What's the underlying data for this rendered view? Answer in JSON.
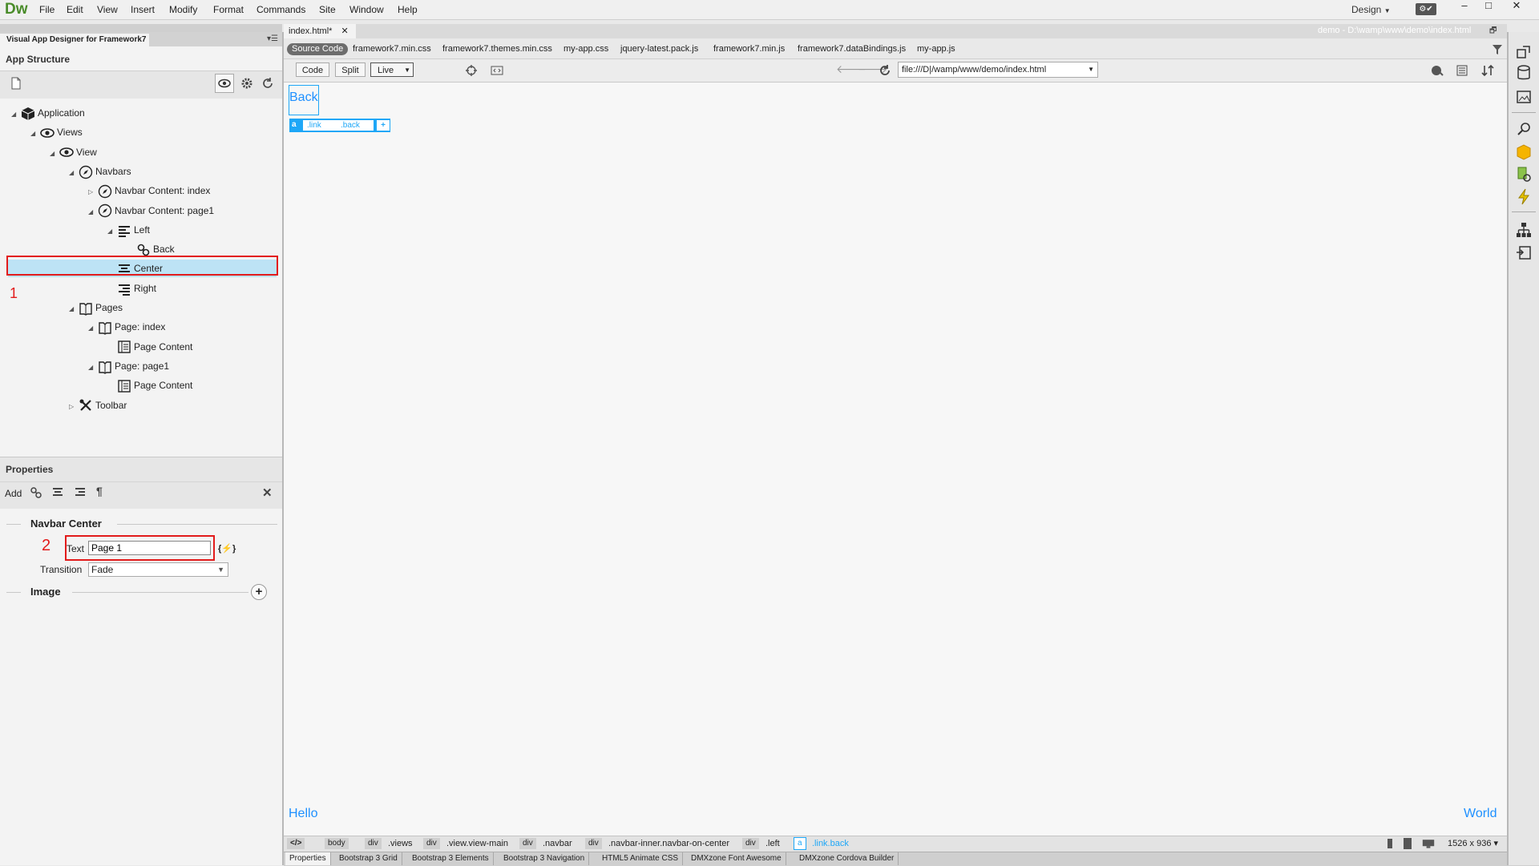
{
  "app": {
    "logo": "Dw",
    "menu": [
      "File",
      "Edit",
      "View",
      "Insert",
      "Modify",
      "Format",
      "Commands",
      "Site",
      "Window",
      "Help"
    ],
    "workspace": "Design",
    "window_controls": [
      "–",
      "□",
      "✕"
    ]
  },
  "left_panel": {
    "tab": "Visual App Designer for Framework7",
    "app_structure_title": "App Structure",
    "tree": [
      {
        "label": "Application",
        "level": 0,
        "arrow": "◢",
        "icon": "cube-icon"
      },
      {
        "label": "Views",
        "level": 1,
        "arrow": "◢",
        "icon": "eye-icon"
      },
      {
        "label": "View",
        "level": 2,
        "arrow": "◢",
        "icon": "eye-icon"
      },
      {
        "label": "Navbars",
        "level": 3,
        "arrow": "◢",
        "icon": "compass-icon"
      },
      {
        "label": "Navbar Content: index",
        "level": 4,
        "arrow": "▷",
        "icon": "compass-icon"
      },
      {
        "label": "Navbar Content: page1",
        "level": 4,
        "arrow": "◢",
        "icon": "compass-icon"
      },
      {
        "label": "Left",
        "level": 5,
        "arrow": "◢",
        "icon": "align-left-icon"
      },
      {
        "label": "Back",
        "level": 6,
        "arrow": "",
        "icon": "link-icon"
      },
      {
        "label": "Center",
        "level": 5,
        "arrow": "",
        "icon": "align-center-icon",
        "selected": true
      },
      {
        "label": "Right",
        "level": 5,
        "arrow": "",
        "icon": "align-right-icon"
      },
      {
        "label": "Pages",
        "level": 3,
        "arrow": "◢",
        "icon": "book-icon"
      },
      {
        "label": "Page: index",
        "level": 4,
        "arrow": "◢",
        "icon": "book-icon"
      },
      {
        "label": "Page Content",
        "level": 5,
        "arrow": "",
        "icon": "page-content-icon"
      },
      {
        "label": "Page: page1",
        "level": 4,
        "arrow": "◢",
        "icon": "book-icon"
      },
      {
        "label": "Page Content",
        "level": 5,
        "arrow": "",
        "icon": "page-content-icon"
      },
      {
        "label": "Toolbar",
        "level": 3,
        "arrow": "▷",
        "icon": "tools-icon"
      }
    ],
    "annotation_1": "1"
  },
  "properties": {
    "title": "Properties",
    "add_label": "Add",
    "section_title": "Navbar Center",
    "text_label": "Text",
    "text_value": "Page 1",
    "binding_glyph": "{⚡}",
    "transition_label": "Transition",
    "transition_value": "Fade",
    "image_section": "Image",
    "annotation_2": "2"
  },
  "document": {
    "tab_name": "index.html*",
    "path": "demo - D:\\wamp\\www\\demo\\index.html",
    "source_code_label": "Source Code",
    "related_files": [
      "framework7.min.css",
      "framework7.themes.min.css",
      "my-app.css",
      "jquery-latest.pack.js",
      "framework7.min.js",
      "framework7.dataBindings.js",
      "my-app.js"
    ],
    "views": [
      "Code",
      "Split",
      "Live"
    ],
    "url": "file:///D|/wamp/www/demo/index.html",
    "canvas": {
      "back_link": "Back",
      "hud_tag": "a",
      "hud_classes": [
        ".link",
        ".back"
      ],
      "hud_add": "+",
      "toolbar_left": "Hello",
      "toolbar_right": "World"
    },
    "tag_selector": {
      "root": "</>",
      "items": [
        {
          "tag": "body",
          "cls": ""
        },
        {
          "tag": "div",
          "cls": ".views"
        },
        {
          "tag": "div",
          "cls": ".view.view-main"
        },
        {
          "tag": "div",
          "cls": ".navbar"
        },
        {
          "tag": "div",
          "cls": ".navbar-inner.navbar-on-center"
        },
        {
          "tag": "div",
          "cls": ".left"
        }
      ],
      "active": {
        "tag": "a",
        "cls": ".link.back"
      },
      "size": "1526 x 936 ▾"
    },
    "bottom_tabs": [
      "Properties",
      "Bootstrap 3 Grid",
      "Bootstrap 3 Elements",
      "Bootstrap 3 Navigation",
      "HTML5 Animate CSS",
      "DMXzone Font Awesome",
      "DMXzone Cordova Builder"
    ]
  },
  "colors": {
    "accent": "#1ea7f7",
    "annotation": "#e21b1b",
    "link": "#1e90ff"
  }
}
